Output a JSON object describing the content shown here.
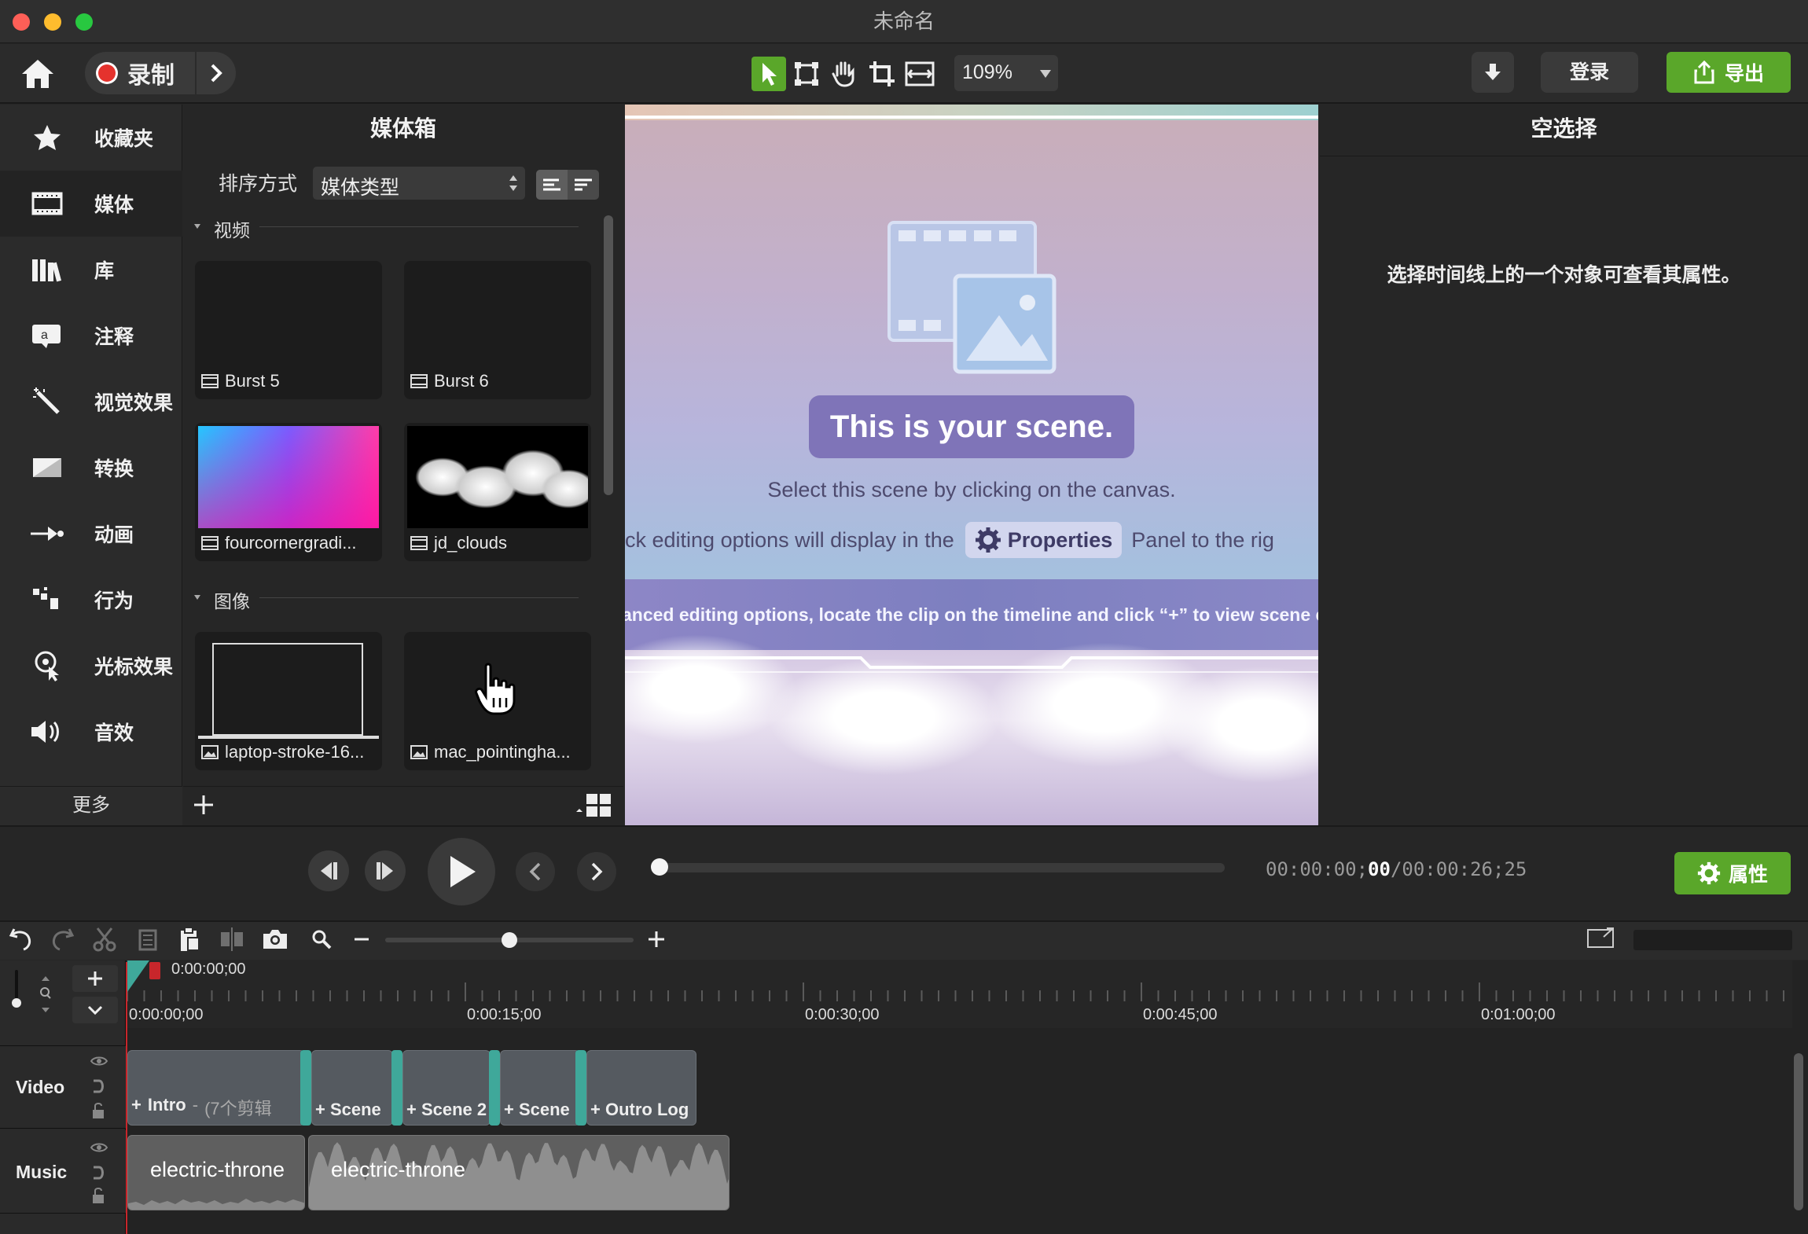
{
  "window": {
    "title": "未命名"
  },
  "toolbar": {
    "record_label": "录制",
    "zoom_value": "109%",
    "login_label": "登录",
    "export_label": "导出"
  },
  "nav": {
    "items": [
      {
        "label": "收藏夹",
        "icon": "star-icon"
      },
      {
        "label": "媒体",
        "icon": "film-icon"
      },
      {
        "label": "库",
        "icon": "library-icon"
      },
      {
        "label": "注释",
        "icon": "annotation-icon"
      },
      {
        "label": "视觉效果",
        "icon": "magic-wand-icon"
      },
      {
        "label": "转换",
        "icon": "transition-icon"
      },
      {
        "label": "动画",
        "icon": "animation-icon"
      },
      {
        "label": "行为",
        "icon": "behavior-icon"
      },
      {
        "label": "光标效果",
        "icon": "cursor-effect-icon"
      },
      {
        "label": "音效",
        "icon": "audio-effect-icon"
      }
    ],
    "more_label": "更多"
  },
  "mediabin": {
    "title": "媒体箱",
    "sort_label": "排序方式",
    "sort_value": "媒体类型",
    "sections": [
      {
        "title": "视频",
        "items": [
          "Burst 5",
          "Burst 6",
          "fourcornergradi...",
          "jd_clouds"
        ]
      },
      {
        "title": "图像",
        "items": [
          "laptop-stroke-16...",
          "mac_pointingha..."
        ]
      }
    ]
  },
  "canvas": {
    "headline": "This is your scene.",
    "line1": "Select this scene by clicking on the canvas.",
    "line2_prefix": "ick editing options will display in the",
    "properties_chip": "Properties",
    "line2_suffix": "Panel to the rig",
    "banner": "anced editing options, locate the clip on the timeline and click “+” to view scene co"
  },
  "properties": {
    "title": "空选择",
    "hint": "选择时间线上的一个对象可查看其属性。"
  },
  "playback": {
    "time_current_a": "00:00:00;",
    "time_current_b": "00",
    "time_total": "/00:00:26;25",
    "props_button": "属性"
  },
  "timeline": {
    "playhead_time": "0:00:00;00",
    "ruler": [
      "0:00:00;00",
      "0:00:15;00",
      "0:00:30;00",
      "0:00:45;00",
      "0:01:00;00"
    ],
    "tracks": [
      {
        "name": "Video",
        "clips": [
          "Intro",
          "(7个剪辑",
          "Scene",
          "Scene 2",
          "Scene",
          "Outro Log"
        ]
      },
      {
        "name": "Music",
        "clips": [
          "electric-throne",
          "electric-throne"
        ]
      }
    ]
  },
  "colors": {
    "accent_green": "#5aa72a",
    "record_red": "#e5322d",
    "clip_marker": "#3fa89a"
  }
}
